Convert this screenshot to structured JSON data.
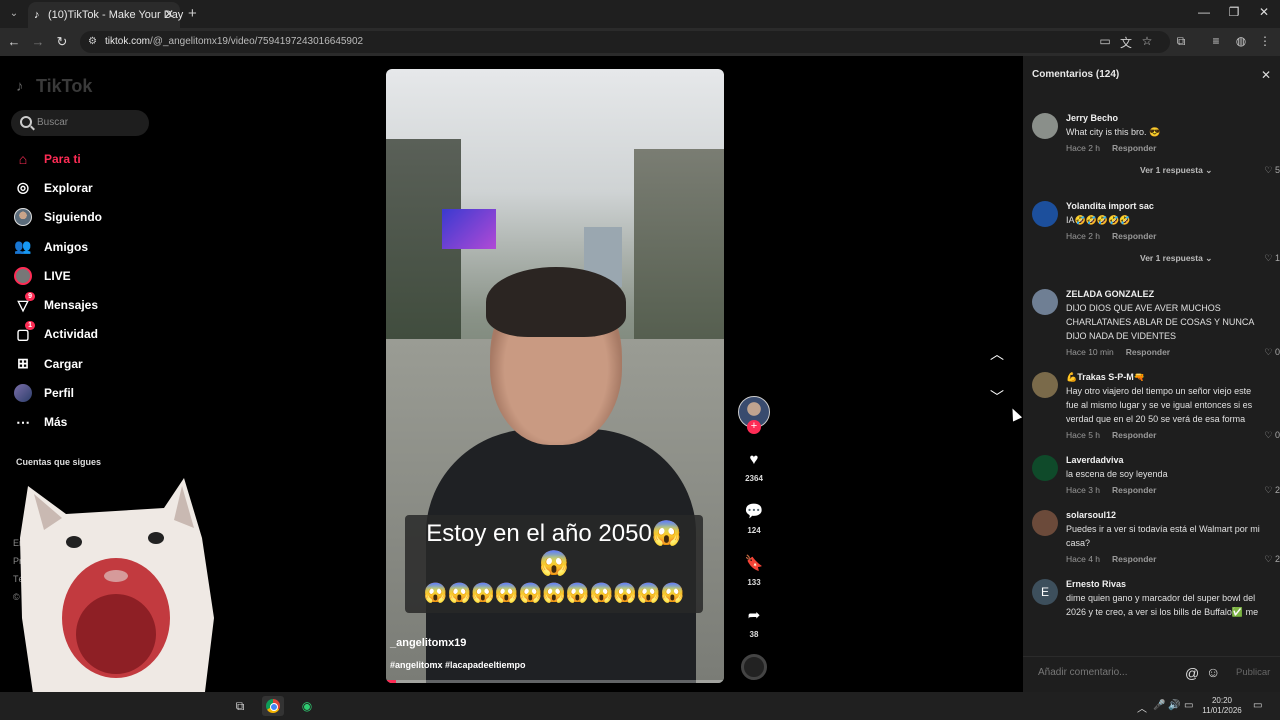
{
  "browser": {
    "tab_title": "(10)TikTok - Make Your Day",
    "url_host": "tiktok.com",
    "url_path": "/@_angelitomx19/video/7594197243016645902"
  },
  "sidebar": {
    "logo": "TikTok",
    "search_placeholder": "Buscar",
    "items": [
      {
        "label": "Para ti",
        "icon": "home-icon"
      },
      {
        "label": "Explorar",
        "icon": "compass-icon"
      },
      {
        "label": "Siguiendo",
        "icon": "following-avatar-icon"
      },
      {
        "label": "Amigos",
        "icon": "friends-icon"
      },
      {
        "label": "LIVE",
        "icon": "live-icon"
      },
      {
        "label": "Mensajes",
        "icon": "messages-icon",
        "badge": "9"
      },
      {
        "label": "Actividad",
        "icon": "activity-icon",
        "badge": "1"
      },
      {
        "label": "Cargar",
        "icon": "upload-icon"
      },
      {
        "label": "Perfil",
        "icon": "profile-icon"
      },
      {
        "label": "Más",
        "icon": "more-icon"
      }
    ],
    "following_title": "Cuentas que sigues",
    "footer": [
      "Empr",
      "Progra",
      "Términ",
      "© 2026 Tik"
    ]
  },
  "video": {
    "caption_line1": "Estoy en el año 2050😱😱",
    "caption_line2": "😱😱😱😱😱😱😱😱😱😱😱",
    "author": "_angelitomx19",
    "tags": "#angelitomx #lacapadeeltiempo",
    "progress": 0.03
  },
  "actions": {
    "likes": "2364",
    "comments": "124",
    "saves": "133",
    "shares": "38"
  },
  "comments_panel": {
    "title": "Comentarios  (124)",
    "input_placeholder": "Añadir comentario...",
    "publish_label": "Publicar",
    "reply_label": "Responder",
    "items": [
      {
        "user": "Jerry Becho",
        "text": "What city is this bro. 😎",
        "time": "Hace 2 h",
        "likes": "5",
        "more": "Ver 1 respuesta"
      },
      {
        "user": "Yolandita import sac",
        "text": "IA🤣🤣🤣🤣🤣",
        "time": "Hace 2 h",
        "likes": "1",
        "more": "Ver 1 respuesta"
      },
      {
        "user": "ZELADA GONZALEZ",
        "text": "DIJO DIOS QUE AVE AVER MUCHOS CHARLATANES ABLAR DE COSAS Y NUNCA DIJO NADA DE VIDENTES",
        "time": "Hace 10 min",
        "likes": "0"
      },
      {
        "user": "💪Trakas S-P-M🔫",
        "text": "Hay otro viajero del tiempo un señor viejo este fue al mismo lugar y se ve igual entonces si es verdad que en el 20 50 se verá de esa forma",
        "time": "Hace 5 h",
        "likes": "0"
      },
      {
        "user": "Laverdadviva",
        "text": "la escena de soy leyenda",
        "time": "Hace 3 h",
        "likes": "2"
      },
      {
        "user": "solarsoul12",
        "text": "Puedes ir a ver si todavía está el Walmart por mi casa?",
        "time": "Hace 4 h",
        "likes": "2"
      },
      {
        "user": "Ernesto Rivas",
        "text": "dime quien gano y marcador del super bowl del 2026 y te creo, a ver si los bills de Buffalo✅ me",
        "time": "",
        "likes": "",
        "avatar_letter": "E"
      }
    ]
  },
  "taskbar": {
    "time": "20:20",
    "date": "11/01/2026"
  }
}
